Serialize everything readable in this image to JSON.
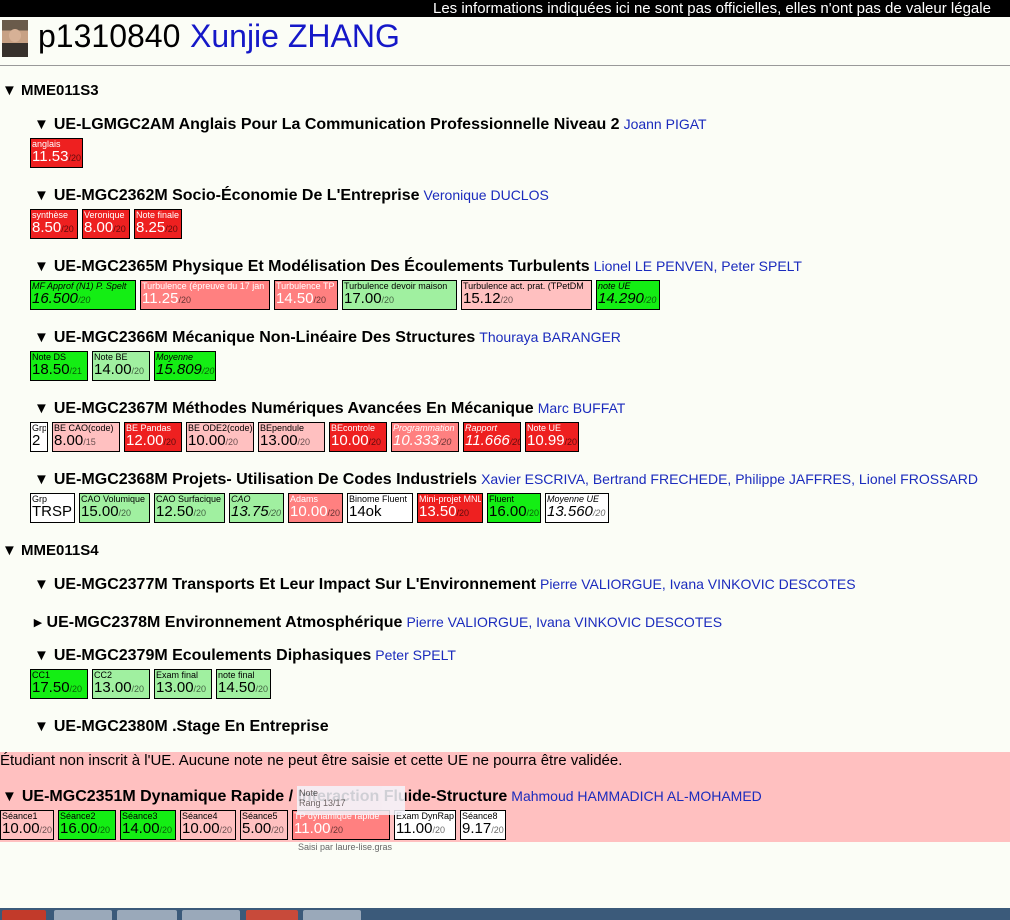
{
  "notice": "Les informations indiquées ici ne sont pas officielles, elles n'ont pas de valeur légale",
  "student": {
    "id": "p1310840",
    "name": "Xunjie ZHANG"
  },
  "semesters": {
    "s3": "MME011S3",
    "s4": "MME011S4"
  },
  "ues": {
    "u1": {
      "title": "UE-LGMGC2AM Anglais Pour La Communication Professionnelle Niveau 2",
      "teachers": "Joann PIGAT",
      "marks": [
        {
          "label": "anglais",
          "value": "11.53",
          "den": "/20"
        }
      ]
    },
    "u2": {
      "title": "UE-MGC2362M Socio-Économie De L'Entreprise",
      "teachers": "Veronique DUCLOS",
      "marks": [
        {
          "label": "synthèse",
          "value": "8.50",
          "den": "/20"
        },
        {
          "label": "Veronique",
          "value": "8.00",
          "den": "/20"
        },
        {
          "label": "Note finale",
          "value": "8.25",
          "den": "/20"
        }
      ]
    },
    "u3": {
      "title": "UE-MGC2365M Physique Et Modélisation Des Écoulements Turbulents",
      "teachers": "Lionel LE PENVEN, Peter SPELT",
      "marks": [
        {
          "label": "MF Approf (N1) P. Spelt",
          "value": "16.500",
          "den": "/20"
        },
        {
          "label": "Turbulence (épreuve du 17 jan",
          "value": "11.25",
          "den": "/20"
        },
        {
          "label": "Turbulence TP",
          "value": "14.50",
          "den": "/20"
        },
        {
          "label": "Turbulence devoir maison",
          "value": "17.00",
          "den": "/20"
        },
        {
          "label": "Turbulence act. prat. (TPetDM",
          "value": "15.12",
          "den": "/20"
        },
        {
          "label": "note UE",
          "value": "14.290",
          "den": "/20"
        }
      ]
    },
    "u4": {
      "title": "UE-MGC2366M Mécanique Non-Linéaire Des Structures",
      "teachers": "Thouraya BARANGER",
      "marks": [
        {
          "label": "Note DS",
          "value": "18.50",
          "den": "/21"
        },
        {
          "label": "Note BE",
          "value": "14.00",
          "den": "/20"
        },
        {
          "label": "Moyenne",
          "value": "15.809",
          "den": "/20"
        }
      ]
    },
    "u5": {
      "title": "UE-MGC2367M Méthodes Numériques Avancées En Mécanique",
      "teachers": "Marc BUFFAT",
      "marks": [
        {
          "label": "Grp",
          "value": "2",
          "den": ""
        },
        {
          "label": "BE CAO(code)",
          "value": "8.00",
          "den": "/15"
        },
        {
          "label": "BE Pandas",
          "value": "12.00",
          "den": "/20"
        },
        {
          "label": "BE ODE2(code)",
          "value": "10.00",
          "den": "/20"
        },
        {
          "label": "BEpendule",
          "value": "13.00",
          "den": "/20"
        },
        {
          "label": "BEcontrole",
          "value": "10.00",
          "den": "/20"
        },
        {
          "label": "Programmation",
          "value": "10.333",
          "den": "/20"
        },
        {
          "label": "Rapport",
          "value": "11.666",
          "den": "/20"
        },
        {
          "label": "Note UE",
          "value": "10.99",
          "den": "/20"
        }
      ]
    },
    "u6": {
      "title": "UE-MGC2368M Projets- Utilisation De Codes Industriels",
      "teachers": "Xavier ESCRIVA, Bertrand FRECHEDE, Philippe JAFFRES, Lionel FROSSARD",
      "marks": [
        {
          "label": "Grp",
          "value": "TRSP",
          "den": ""
        },
        {
          "label": "CAO Volumique",
          "value": "15.00",
          "den": "/20"
        },
        {
          "label": "CAO Surfacique",
          "value": "12.50",
          "den": "/20"
        },
        {
          "label": "CAO",
          "value": "13.75",
          "den": "/20"
        },
        {
          "label": "Adams",
          "value": "10.00",
          "den": "/20"
        },
        {
          "label": "Binome Fluent",
          "value": "14ok",
          "den": ""
        },
        {
          "label": "Mini-projet MNL",
          "value": "13.50",
          "den": "/20"
        },
        {
          "label": "Fluent",
          "value": "16.00",
          "den": "/20"
        },
        {
          "label": "Moyenne UE",
          "value": "13.560",
          "den": "/20"
        }
      ]
    },
    "u7": {
      "title": "UE-MGC2377M Transports Et Leur Impact Sur L'Environnement",
      "teachers": "Pierre VALIORGUE, Ivana VINKOVIC DESCOTES"
    },
    "u8": {
      "title": "UE-MGC2378M Environnement Atmosphérique",
      "teachers": "Pierre VALIORGUE, Ivana VINKOVIC DESCOTES"
    },
    "u9": {
      "title": "UE-MGC2379M Ecoulements Diphasiques",
      "teachers": "Peter SPELT",
      "marks": [
        {
          "label": "CC1",
          "value": "17.50",
          "den": "/20"
        },
        {
          "label": "CC2",
          "value": "13.00",
          "den": "/20"
        },
        {
          "label": "Exam final",
          "value": "13.00",
          "den": "/20"
        },
        {
          "label": "note final",
          "value": "14.50",
          "den": "/20"
        }
      ]
    },
    "u10": {
      "title": "UE-MGC2380M .Stage En Entreprise",
      "teachers": ""
    },
    "u11": {
      "title": "UE-MGC2351M Dynamique Rapide / Interaction Fluide-Structure",
      "teachers": "Mahmoud HAMMADICH AL-MOHAMED",
      "marks": [
        {
          "label": "Séance1",
          "value": "10.00",
          "den": "/20"
        },
        {
          "label": "Séance2",
          "value": "16.00",
          "den": "/20"
        },
        {
          "label": "Séance3",
          "value": "14.00",
          "den": "/20"
        },
        {
          "label": "Séance4",
          "value": "10.00",
          "den": "/20"
        },
        {
          "label": "Séance5",
          "value": "5.00",
          "den": "/20"
        },
        {
          "label": "TP dynamique rapide",
          "value": "11.00",
          "den": "/20"
        },
        {
          "label": "Exam DynRap",
          "value": "11.00",
          "den": "/20"
        },
        {
          "label": "Séance8",
          "value": "9.17",
          "den": "/20"
        }
      ]
    }
  },
  "warning": "Étudiant non inscrit à l'UE. Aucune note ne peut être saisie et cette UE ne pourra être validée.",
  "tooltip": {
    "line1": "Note",
    "line2": "Rang 13/17",
    "saisi": "Saisi par laure-lise.gras"
  }
}
